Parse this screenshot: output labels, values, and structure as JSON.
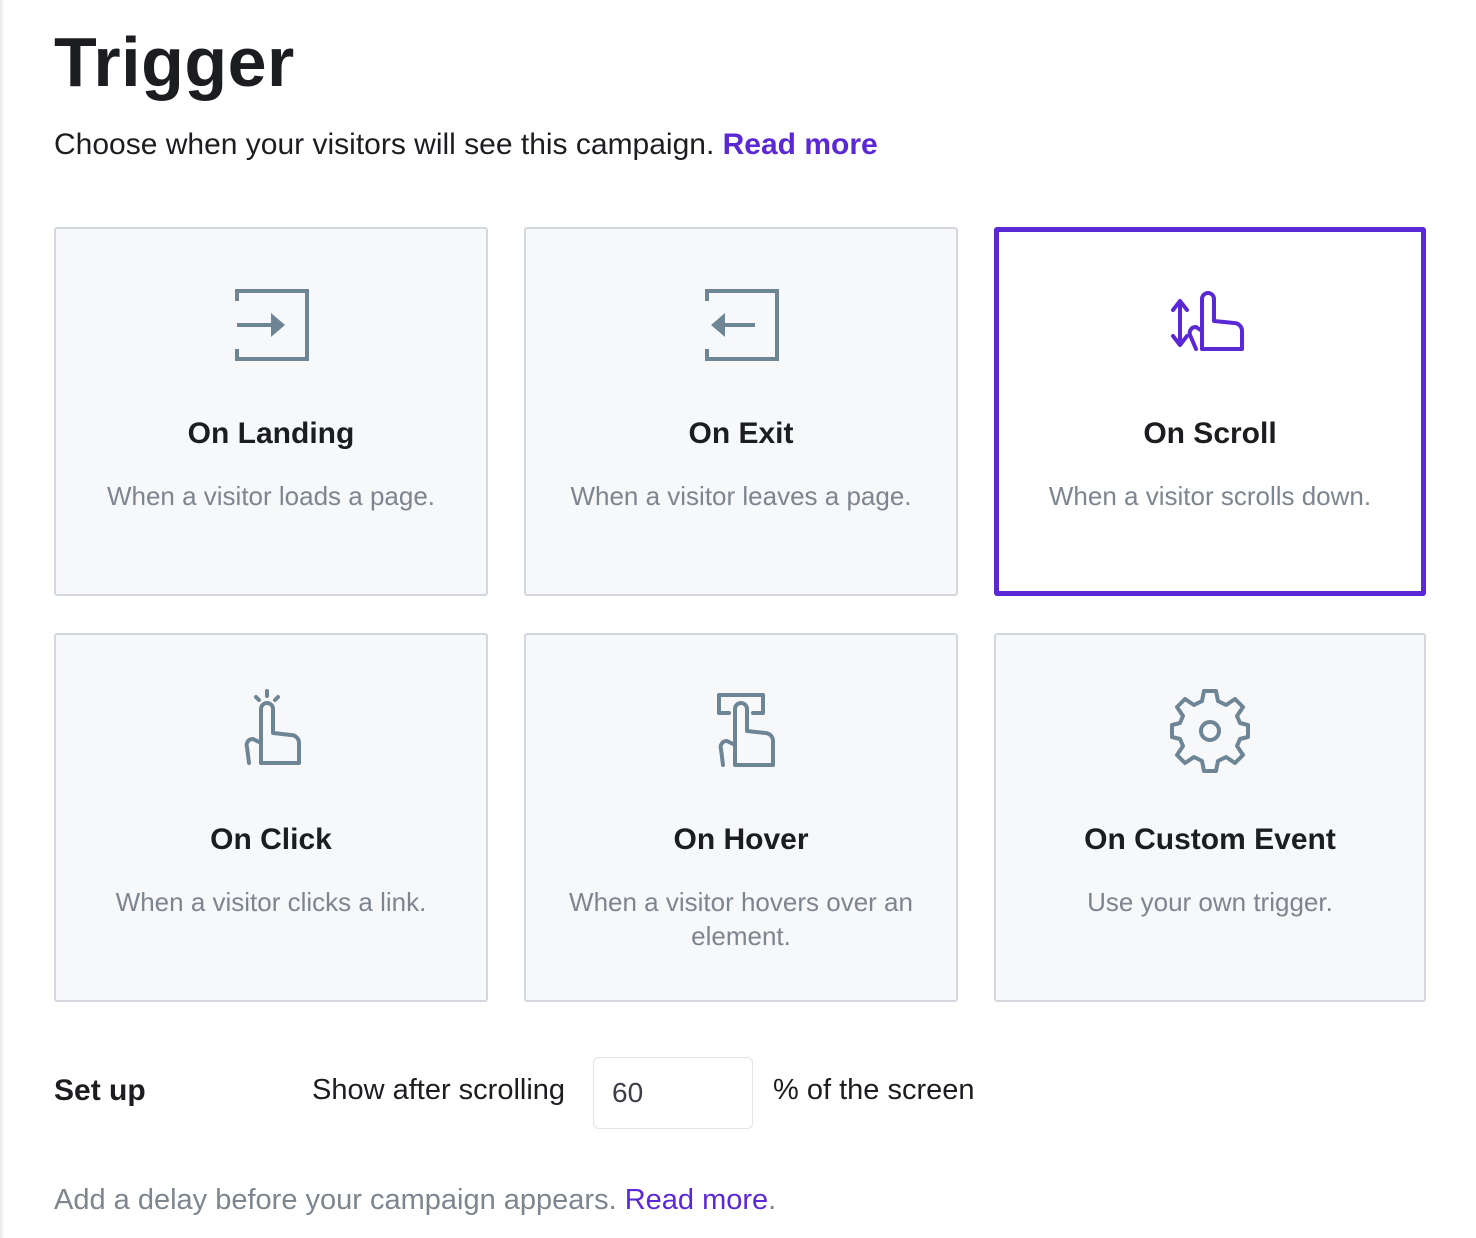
{
  "header": {
    "title": "Trigger",
    "subtitle": "Choose when your visitors will see this campaign.",
    "read_more": "Read more"
  },
  "colors": {
    "accent": "#5b28d6",
    "icon_gray": "#6e8595",
    "card_bg": "#f7f8fa",
    "card_border": "#d4d8de"
  },
  "triggers": [
    {
      "title": "On Landing",
      "description": "When a visitor loads a page.",
      "icon": "enter-icon",
      "selected": false
    },
    {
      "title": "On Exit",
      "description": "When a visitor leaves a page.",
      "icon": "exit-icon",
      "selected": false
    },
    {
      "title": "On Scroll",
      "description": "When a visitor scrolls down.",
      "icon": "scroll-hand-icon",
      "selected": true
    },
    {
      "title": "On Click",
      "description": "When a visitor clicks a link.",
      "icon": "click-hand-icon",
      "selected": false
    },
    {
      "title": "On Hover",
      "description": "When a visitor hovers over an element.",
      "icon": "hover-hand-icon",
      "selected": false
    },
    {
      "title": "On Custom Event",
      "description": "Use your own trigger.",
      "icon": "gear-icon",
      "selected": false
    }
  ],
  "setup": {
    "label": "Set up",
    "scroll_label": "Show after scrolling",
    "scroll_value": "60",
    "scroll_suffix": "% of the screen"
  },
  "delay": {
    "text": "Add a delay before your campaign appears.",
    "read_more": "Read more",
    "trailing": "."
  }
}
